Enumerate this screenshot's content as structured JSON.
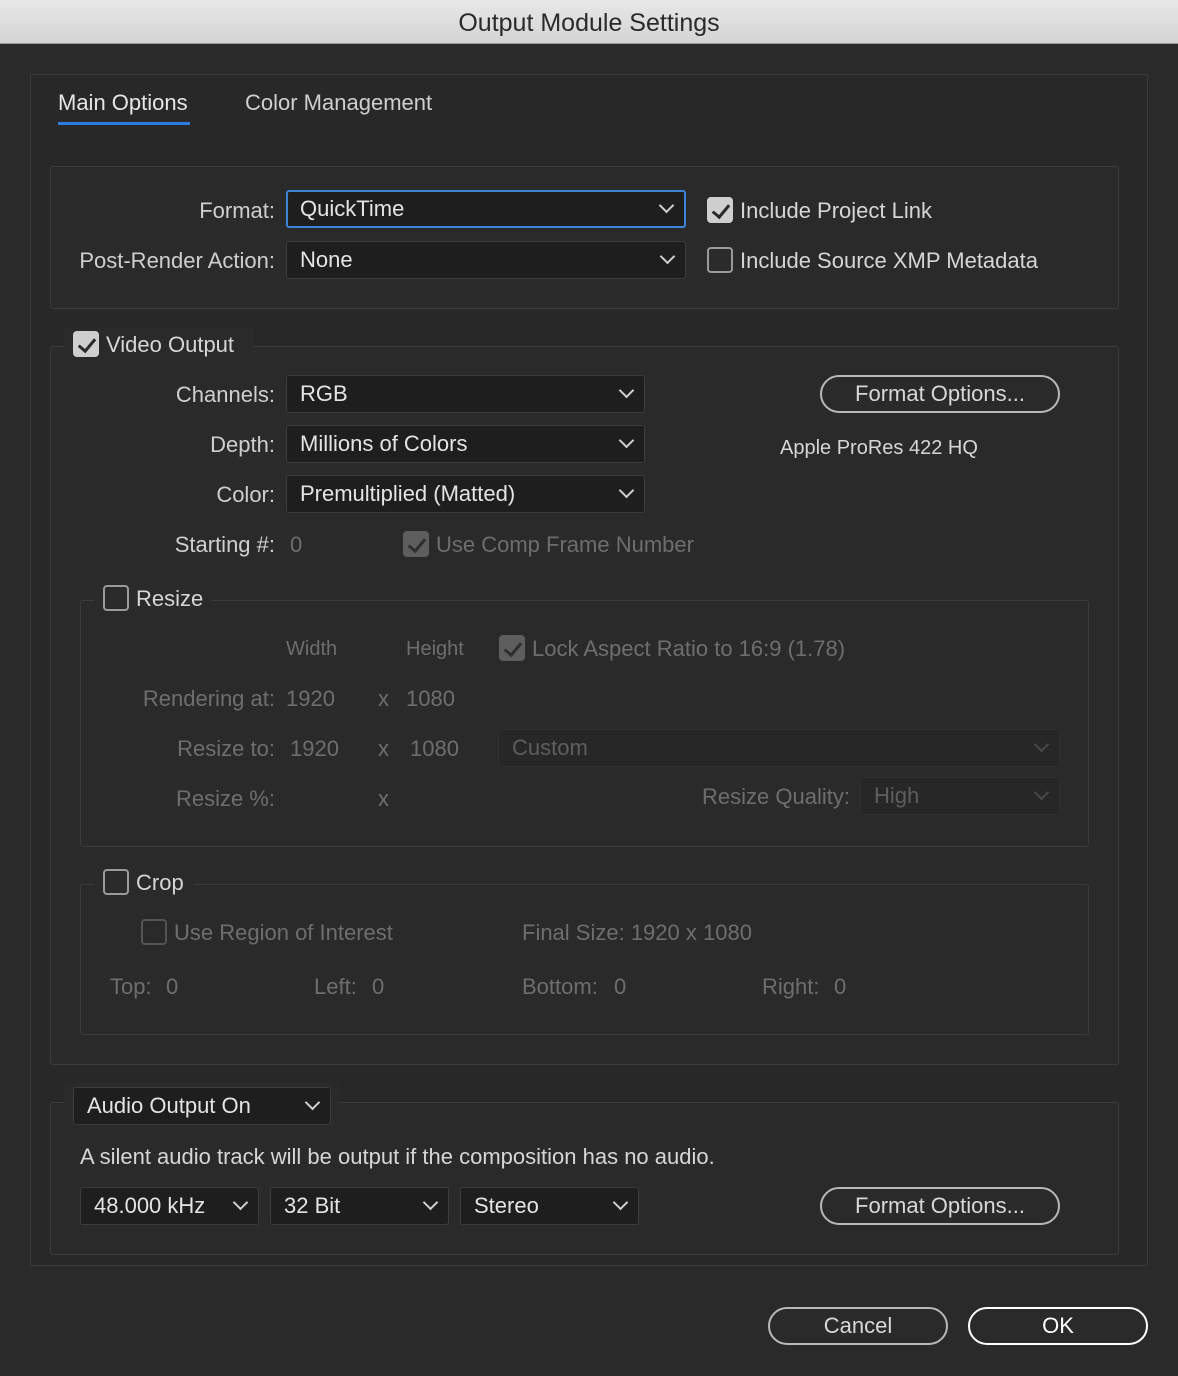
{
  "window": {
    "title": "Output Module Settings"
  },
  "tabs": [
    {
      "label": "Main Options",
      "active": true
    },
    {
      "label": "Color Management",
      "active": false
    }
  ],
  "general": {
    "format_label": "Format:",
    "format_value": "QuickTime",
    "post_render_label": "Post-Render Action:",
    "post_render_value": "None",
    "include_project_link": {
      "label": "Include Project Link",
      "checked": true
    },
    "include_xmp": {
      "label": "Include Source XMP Metadata",
      "checked": false
    }
  },
  "video": {
    "toggle": {
      "label": "Video Output",
      "checked": true
    },
    "channels_label": "Channels:",
    "channels_value": "RGB",
    "depth_label": "Depth:",
    "depth_value": "Millions of Colors",
    "color_label": "Color:",
    "color_value": "Premultiplied (Matted)",
    "starting_label": "Starting #:",
    "starting_value": "0",
    "use_comp_frame": {
      "label": "Use Comp Frame Number",
      "checked": true
    },
    "format_options_label": "Format Options...",
    "codec_text": "Apple ProRes 422 HQ"
  },
  "resize": {
    "toggle": {
      "label": "Resize",
      "checked": false
    },
    "width_header": "Width",
    "height_header": "Height",
    "lock_aspect": {
      "label": "Lock Aspect Ratio to 16:9 (1.78)",
      "checked": true
    },
    "rendering_label": "Rendering at:",
    "rendering_w": "1920",
    "rendering_h": "1080",
    "resize_to_label": "Resize to:",
    "resize_to_w": "1920",
    "resize_to_h": "1080",
    "preset_value": "Custom",
    "percent_label": "Resize %:",
    "x_sep": "x",
    "quality_label": "Resize Quality:",
    "quality_value": "High"
  },
  "crop": {
    "toggle": {
      "label": "Crop",
      "checked": false
    },
    "roi": {
      "label": "Use Region of Interest",
      "checked": false
    },
    "final_size": "Final Size: 1920 x 1080",
    "top_label": "Top:",
    "top_value": "0",
    "left_label": "Left:",
    "left_value": "0",
    "bottom_label": "Bottom:",
    "bottom_value": "0",
    "right_label": "Right:",
    "right_value": "0"
  },
  "audio": {
    "mode_value": "Audio Output On",
    "note": "A silent audio track will be output if the composition has no audio.",
    "rate_value": "48.000 kHz",
    "depth_value": "32 Bit",
    "channels_value": "Stereo",
    "format_options_label": "Format Options..."
  },
  "footer": {
    "cancel_label": "Cancel",
    "ok_label": "OK"
  }
}
